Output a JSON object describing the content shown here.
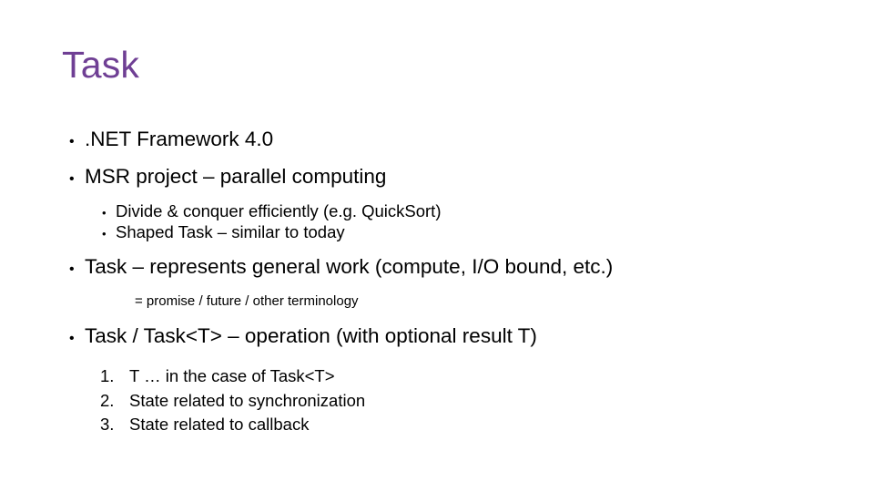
{
  "slide": {
    "title": "Task",
    "title_color": "#6f3f94",
    "background_color": "#ffffff",
    "text_color": "#000000",
    "bullet_glyph": "•",
    "blocks": [
      {
        "level": 1,
        "marker": "•",
        "text": ".NET Framework 4.0"
      },
      {
        "level": 1,
        "marker": "•",
        "text": "MSR project – parallel computing"
      },
      {
        "level": 2,
        "marker": "•",
        "text": "Divide & conquer efficiently (e.g. QuickSort)"
      },
      {
        "level": 2,
        "marker": "•",
        "text": "Shaped Task – similar to today"
      },
      {
        "level": 1,
        "marker": "•",
        "text": "Task – represents general work (compute, I/O bound, etc.)"
      },
      {
        "level": 3,
        "marker": "",
        "text": "= promise  / future / other terminology"
      },
      {
        "level": 1,
        "marker": "•",
        "text": "Task / Task<T> – operation (with optional result T)"
      },
      {
        "level": 4,
        "marker": "1.",
        "text": "T … in the case of Task<T>"
      },
      {
        "level": 4,
        "marker": "2.",
        "text": "State related to synchronization"
      },
      {
        "level": 4,
        "marker": "3.",
        "text": "State related to callback"
      }
    ]
  }
}
